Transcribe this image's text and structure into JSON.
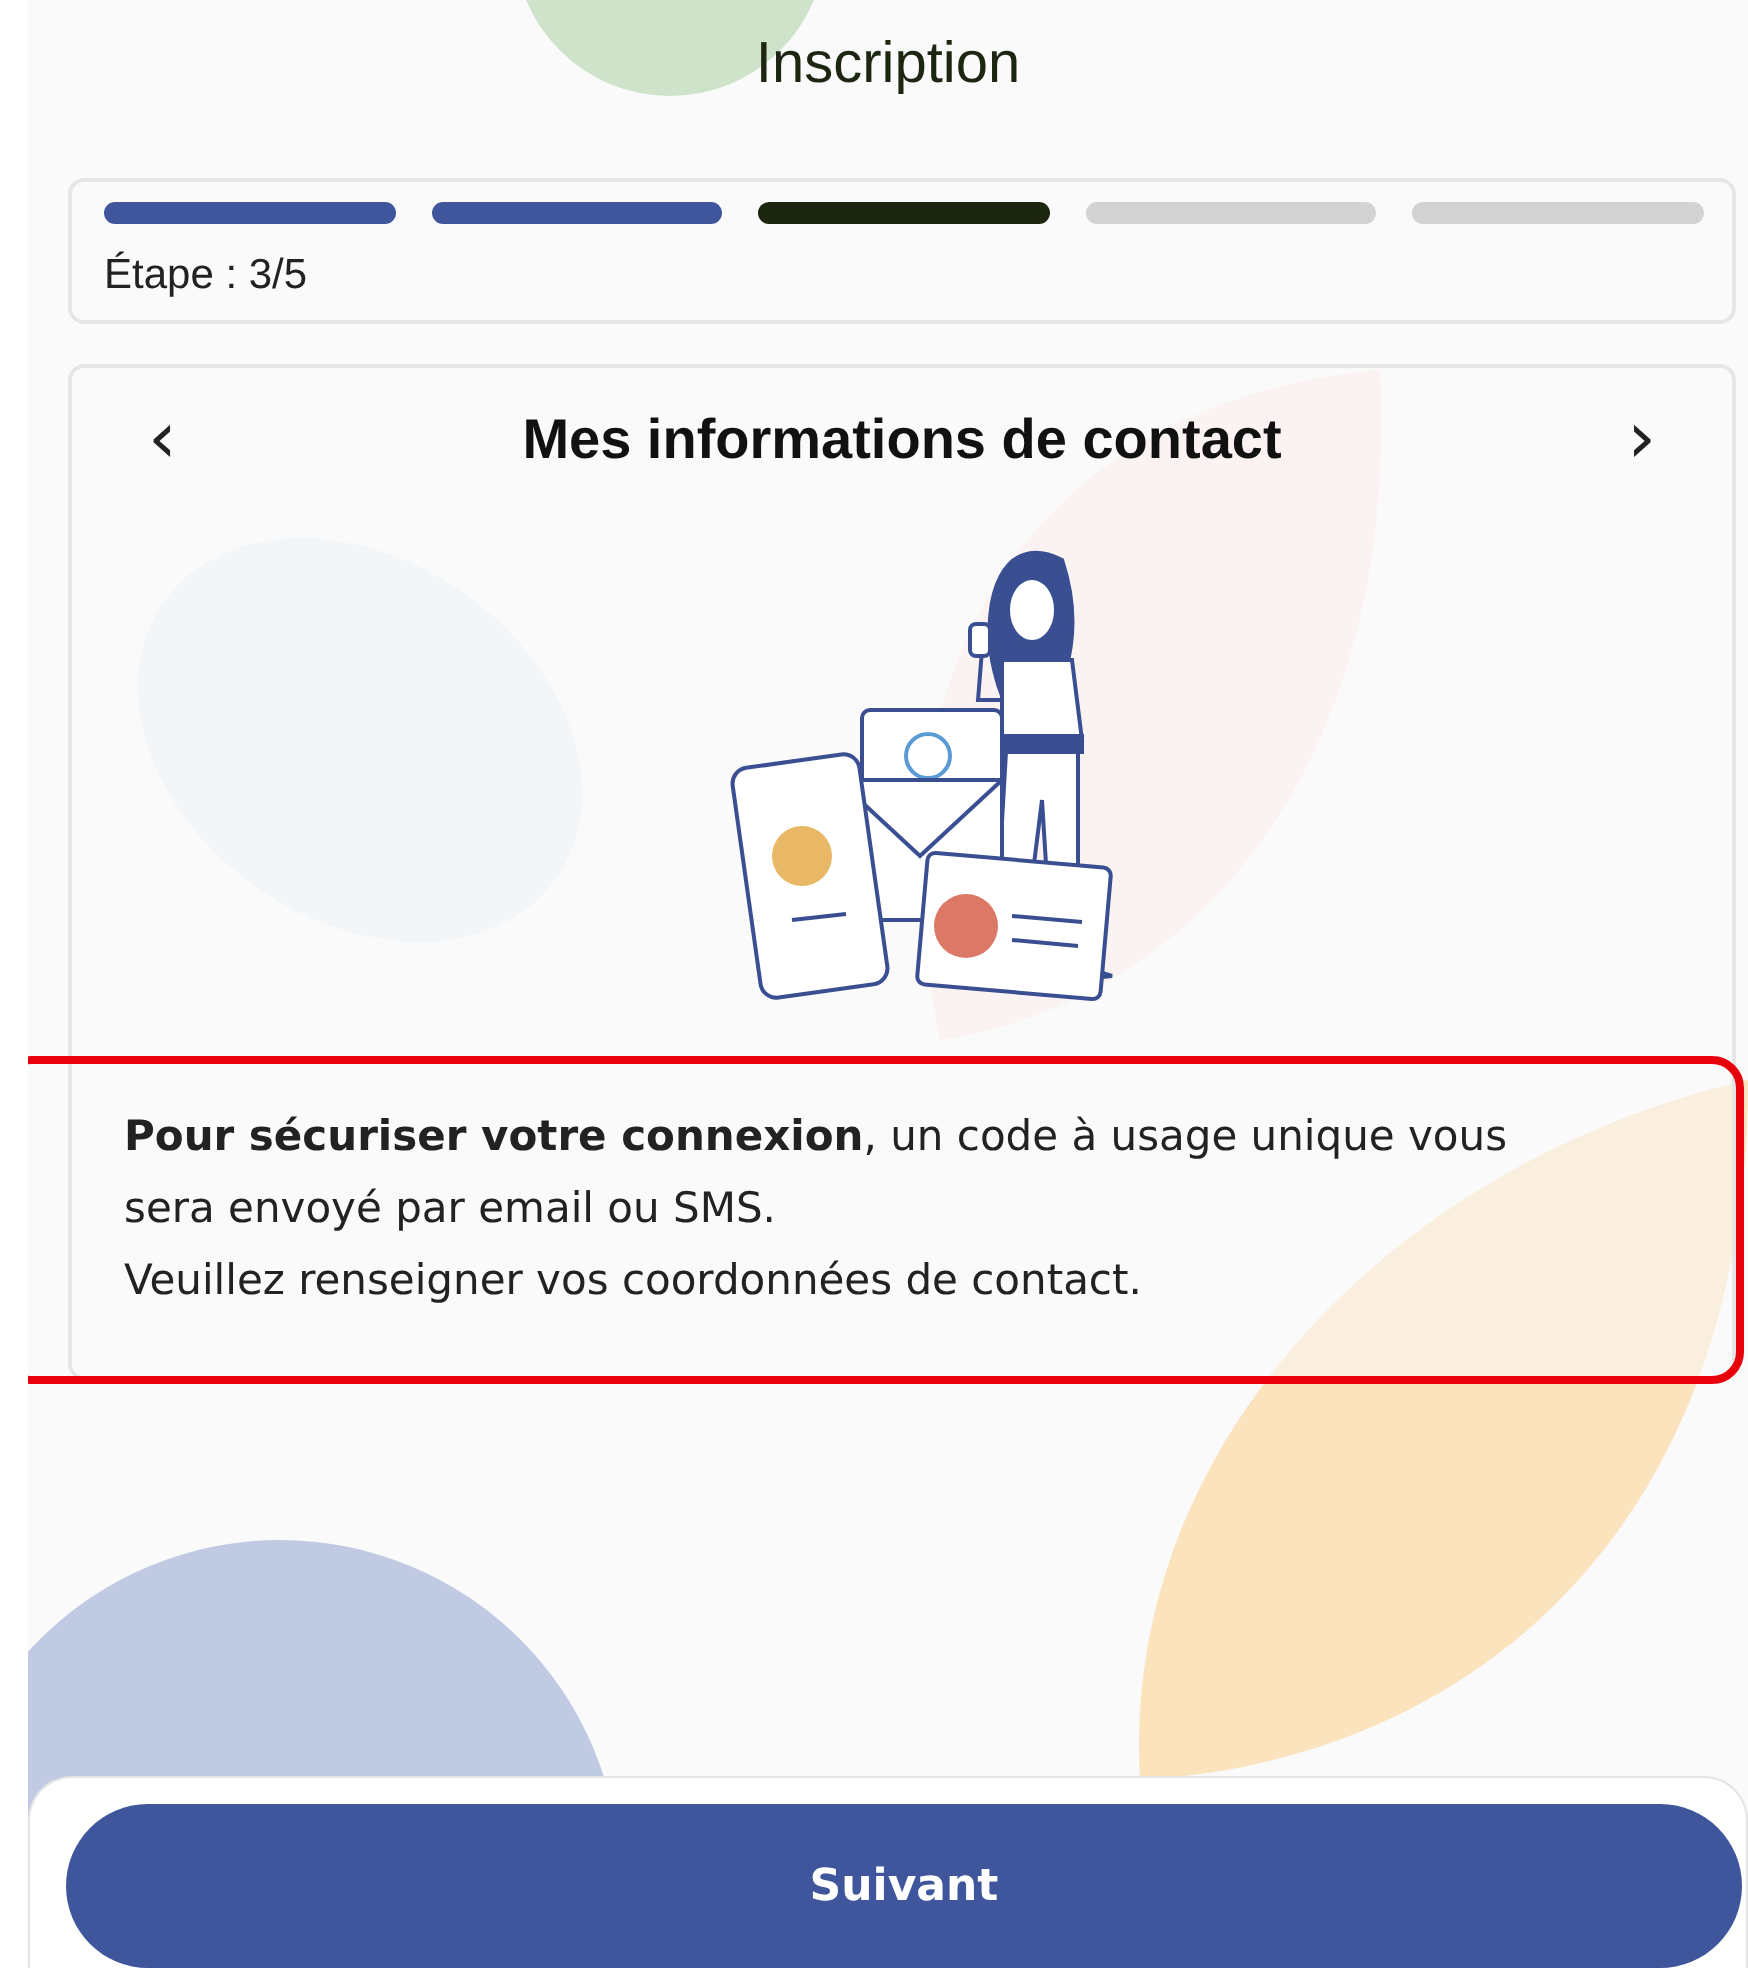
{
  "header": {
    "title": "Inscription"
  },
  "progress": {
    "steps": [
      {
        "done": true,
        "selected": false
      },
      {
        "done": true,
        "selected": false
      },
      {
        "done": false,
        "selected": true
      },
      {
        "done": false,
        "selected": false
      },
      {
        "done": false,
        "selected": false
      }
    ],
    "label": "Étape : 3/5"
  },
  "card": {
    "prev": "‹",
    "title": "Mes informations de contact",
    "next": "›"
  },
  "info": {
    "highlighted": true,
    "paragraphs": [
      "**Pour sécuriser votre connexion**, un code à usage unique vous sera envoyé par email ou SMS.",
      "Veuillez renseigner vos coordonnées de contact."
    ]
  },
  "footer": {
    "button": "Suivant"
  }
}
